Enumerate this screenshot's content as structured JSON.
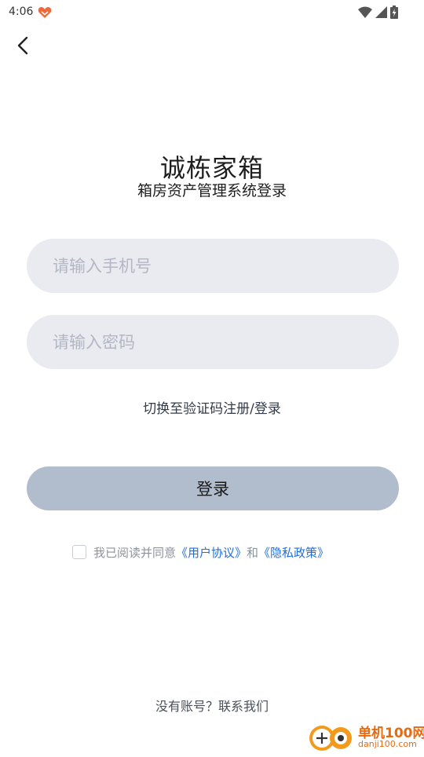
{
  "status_bar": {
    "time": "4:06",
    "app_icon": "heart-app-icon",
    "icons": [
      "wifi-icon",
      "signal-icon",
      "battery-charging-icon"
    ]
  },
  "nav": {
    "back_icon": "chevron-left-icon"
  },
  "header": {
    "title": "诚栋家箱",
    "subtitle": "箱房资产管理系统登录"
  },
  "form": {
    "phone_placeholder": "请输入手机号",
    "password_placeholder": "请输入密码",
    "switch_label": "切换至验证码注册/登录",
    "login_label": "登录"
  },
  "agreement": {
    "checked": false,
    "prefix": "我已阅读并同意",
    "user_agreement": "《用户协议》",
    "connector": "和",
    "privacy_policy": "《隐私政策》"
  },
  "footer": {
    "contact_label": "没有账号？联系我们"
  },
  "watermark": {
    "line1": "单机100网",
    "line2": "danji100.com"
  },
  "colors": {
    "input_bg": "#e9ebf0",
    "placeholder": "#b2b7c3",
    "button_bg": "#b1bccd",
    "link": "#1f6fe0",
    "app_icon": "#ef6a3a"
  }
}
